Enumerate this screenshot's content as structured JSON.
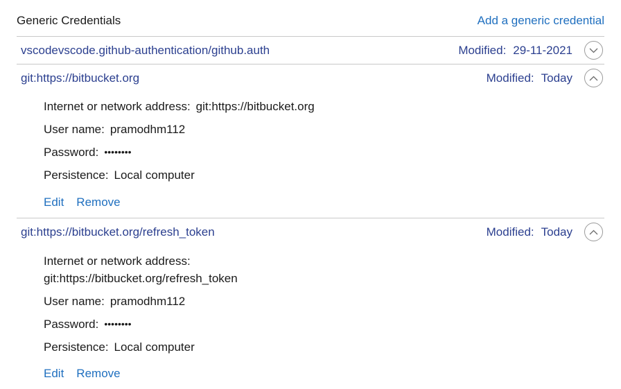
{
  "header": {
    "title": "Generic Credentials",
    "add_link": "Add a generic credential"
  },
  "credentials": [
    {
      "name": "vscodevscode.github-authentication/github.auth",
      "modified_label": "Modified:",
      "modified_value": "29-11-2021",
      "expanded": false,
      "chevron_icon": "chevron-down-icon"
    },
    {
      "name": "git:https://bitbucket.org",
      "modified_label": "Modified:",
      "modified_value": "Today",
      "expanded": true,
      "chevron_icon": "chevron-up-icon",
      "address_label": "Internet or network address:",
      "address_value": "git:https://bitbucket.org",
      "username_label": "User name:",
      "username_value": "pramodhm112",
      "password_label": "Password:",
      "password_value": "••••••••",
      "persistence_label": "Persistence:",
      "persistence_value": "Local computer",
      "edit_label": "Edit",
      "remove_label": "Remove"
    },
    {
      "name": "git:https://bitbucket.org/refresh_token",
      "modified_label": "Modified:",
      "modified_value": "Today",
      "expanded": true,
      "chevron_icon": "chevron-up-icon",
      "address_label": "Internet or network address:",
      "address_value": "git:https://bitbucket.org/refresh_token",
      "username_label": "User name:",
      "username_value": "pramodhm112",
      "password_label": "Password:",
      "password_value": "••••••••",
      "persistence_label": "Persistence:",
      "persistence_value": "Local computer",
      "edit_label": "Edit",
      "remove_label": "Remove"
    }
  ],
  "colors": {
    "link": "#1f6fbf",
    "item_title": "#2b3f8f",
    "divider": "#c8c8c8"
  }
}
